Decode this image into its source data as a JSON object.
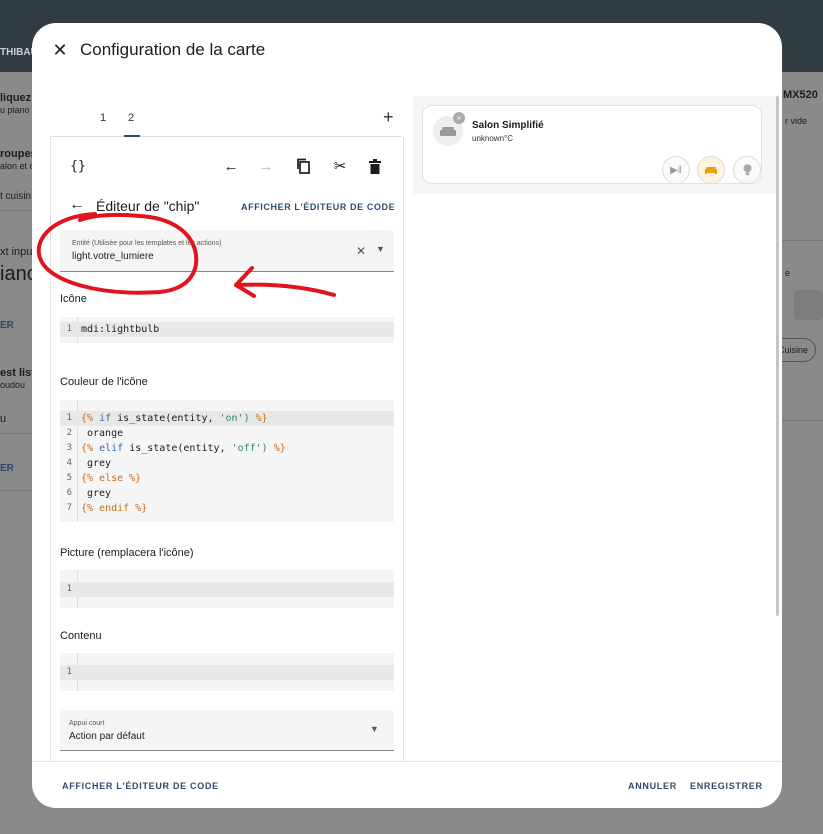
{
  "background": {
    "top_user_fragment": "THIBAU",
    "top_right_fragment": "MX520",
    "left_fragments": [
      "liquez p",
      "u piano",
      "roupes",
      "alon et c",
      "t cuisin",
      "xt inpu",
      "ianc",
      "ER",
      "est list",
      "oudou",
      "u",
      "ER"
    ],
    "right_fragments": [
      "r vide",
      "e"
    ],
    "right_chip": "Cuisine"
  },
  "dialog": {
    "title": "Configuration de la carte",
    "tabs": [
      "1",
      "2"
    ],
    "active_tab": "2",
    "add_icon": "plus-icon",
    "toolbar_icons": [
      "code-braces-icon",
      "undo-icon",
      "redo-icon",
      "copy-icon",
      "cut-icon",
      "delete-icon"
    ],
    "subeditor": {
      "title": "Éditeur de \"chip\"",
      "code_editor_link": "AFFICHER L'ÉDITEUR DE CODE"
    },
    "entity_field": {
      "label": "Entité (Utilisée pour les templates et les actions)",
      "value": "light.votre_lumiere"
    },
    "icon_section": {
      "label": "Icône",
      "lines": [
        {
          "num": "1",
          "text": "mdi:lightbulb"
        }
      ]
    },
    "icon_color_section": {
      "label": "Couleur de l'icône",
      "line_numbers": [
        "1",
        "2",
        "3",
        "4",
        "5",
        "6",
        "7"
      ],
      "l1": {
        "a": "{%",
        "b": "if",
        "c": "is_state(entity,",
        "d": "'on')",
        "e": "%}"
      },
      "l2": "orange",
      "l3": {
        "a": "{%",
        "b": "elif",
        "c": "is_state(entity,",
        "d": "'off')",
        "e": "%}"
      },
      "l4": "grey",
      "l5": "{% else %}",
      "l6": "grey",
      "l7": "{% endif %}"
    },
    "picture_section": {
      "label": "Picture (remplacera l'icône)",
      "lines": [
        {
          "num": "1",
          "text": ""
        }
      ]
    },
    "content_section": {
      "label": "Contenu",
      "lines": [
        {
          "num": "1",
          "text": ""
        }
      ]
    },
    "tap_action": {
      "label": "Appui court",
      "value": "Action par défaut"
    },
    "preview_card": {
      "name": "Salon Simplifié",
      "state": "unknown°C",
      "chips": [
        "play-pause-icon",
        "sofa-icon",
        "lightbulb-icon"
      ]
    },
    "footer": {
      "show_code": "AFFICHER L'ÉDITEUR DE CODE",
      "cancel": "ANNULER",
      "save": "ENREGISTRER"
    }
  },
  "colors": {
    "accent": "#2f4c6e",
    "annotation": "#e0141e",
    "chip_orange": "#f0a000"
  }
}
